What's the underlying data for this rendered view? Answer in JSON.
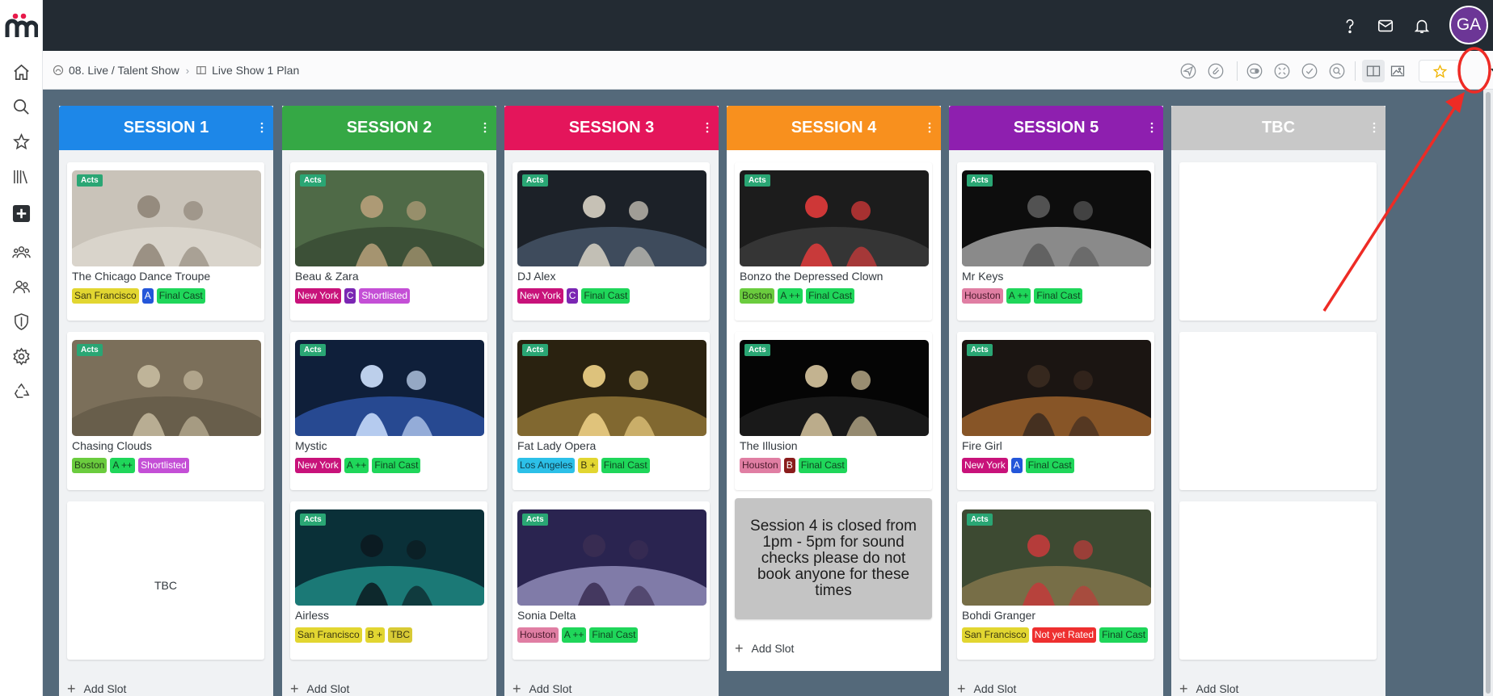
{
  "topbar": {
    "avatar_initials": "GA",
    "icons": [
      "help-icon",
      "mail-icon",
      "bell-icon"
    ]
  },
  "breadcrumb": {
    "workspace": "08. Live / Talent Show",
    "board": "Live Show 1 Plan"
  },
  "colors": {
    "session1": "#1d87e8",
    "session2": "#35a845",
    "session3": "#e4155b",
    "session4": "#f8901e",
    "session5": "#8e1faf",
    "tbc": "#c8c8c8",
    "acts_badge": "#2aa674",
    "annotation": "#ee2b25"
  },
  "columns": [
    {
      "title": "SESSION 1",
      "add_slot": "Add Slot",
      "cards": [
        {
          "badge": "Acts",
          "title": "The Chicago Dance Troupe",
          "tags": [
            {
              "t": "San Francisco",
              "bg": "#e2d631",
              "fg": "#3b3710"
            },
            {
              "t": "A",
              "bg": "#2456d9",
              "fg": "#ffffff"
            },
            {
              "t": "Final Cast",
              "bg": "#1fd65a",
              "fg": "#0f4521"
            }
          ]
        },
        {
          "badge": "Acts",
          "title": "Chasing Clouds",
          "tags": [
            {
              "t": "Boston",
              "bg": "#6bcc3e",
              "fg": "#23401a"
            },
            {
              "t": "A ++",
              "bg": "#1fd65a",
              "fg": "#0f4521"
            },
            {
              "t": "Shortlisted",
              "bg": "#c44fd6",
              "fg": "#ffffff"
            }
          ]
        },
        {
          "empty": "TBC"
        }
      ]
    },
    {
      "title": "SESSION 2",
      "add_slot": "Add Slot",
      "cards": [
        {
          "badge": "Acts",
          "title": "Beau & Zara",
          "tags": [
            {
              "t": "New York",
              "bg": "#c8127a",
              "fg": "#ffffff"
            },
            {
              "t": "C",
              "bg": "#7b26b3",
              "fg": "#ffffff"
            },
            {
              "t": "Shortlisted",
              "bg": "#c44fd6",
              "fg": "#ffffff"
            }
          ]
        },
        {
          "badge": "Acts",
          "title": "Mystic",
          "tags": [
            {
              "t": "New York",
              "bg": "#c8127a",
              "fg": "#ffffff"
            },
            {
              "t": "A ++",
              "bg": "#1fd65a",
              "fg": "#0f4521"
            },
            {
              "t": "Final Cast",
              "bg": "#1fd65a",
              "fg": "#0f4521"
            }
          ]
        },
        {
          "badge": "Acts",
          "title": "Airless",
          "tags": [
            {
              "t": "San Francisco",
              "bg": "#e2d631",
              "fg": "#3b3710"
            },
            {
              "t": "B +",
              "bg": "#e2d631",
              "fg": "#3b3710"
            },
            {
              "t": "TBC",
              "bg": "#d8ca35",
              "fg": "#3b3710"
            }
          ]
        }
      ]
    },
    {
      "title": "SESSION 3",
      "add_slot": "Add Slot",
      "cards": [
        {
          "badge": "Acts",
          "title": "DJ Alex",
          "tags": [
            {
              "t": "New York",
              "bg": "#c8127a",
              "fg": "#ffffff"
            },
            {
              "t": "C",
              "bg": "#7b26b3",
              "fg": "#ffffff"
            },
            {
              "t": "Final Cast",
              "bg": "#1fd65a",
              "fg": "#0f4521"
            }
          ]
        },
        {
          "badge": "Acts",
          "title": "Fat Lady Opera",
          "tags": [
            {
              "t": "Los Angeles",
              "bg": "#2cc0e8",
              "fg": "#0f3d4a"
            },
            {
              "t": "B +",
              "bg": "#e2d631",
              "fg": "#3b3710"
            },
            {
              "t": "Final Cast",
              "bg": "#1fd65a",
              "fg": "#0f4521"
            }
          ]
        },
        {
          "badge": "Acts",
          "title": "Sonia Delta",
          "tags": [
            {
              "t": "Houston",
              "bg": "#e07ea3",
              "fg": "#4a1a2c"
            },
            {
              "t": "A ++",
              "bg": "#1fd65a",
              "fg": "#0f4521"
            },
            {
              "t": "Final Cast",
              "bg": "#1fd65a",
              "fg": "#0f4521"
            }
          ]
        }
      ]
    },
    {
      "title": "SESSION 4",
      "add_slot": "Add Slot",
      "cards": [
        {
          "badge": "Acts",
          "title": "Bonzo the Depressed Clown",
          "tags": [
            {
              "t": "Boston",
              "bg": "#6bcc3e",
              "fg": "#23401a"
            },
            {
              "t": "A ++",
              "bg": "#1fd65a",
              "fg": "#0f4521"
            },
            {
              "t": "Final Cast",
              "bg": "#1fd65a",
              "fg": "#0f4521"
            }
          ]
        },
        {
          "badge": "Acts",
          "title": "The Illusion",
          "tags": [
            {
              "t": "Houston",
              "bg": "#e07ea3",
              "fg": "#4a1a2c"
            },
            {
              "t": "B",
              "bg": "#8a1c1c",
              "fg": "#ffffff"
            },
            {
              "t": "Final Cast",
              "bg": "#1fd65a",
              "fg": "#0f4521"
            }
          ]
        },
        {
          "note": "Session 4 is closed from 1pm - 5pm for sound checks please do not book anyone for these times"
        }
      ]
    },
    {
      "title": "SESSION 5",
      "add_slot": "Add Slot",
      "cards": [
        {
          "badge": "Acts",
          "title": "Mr Keys",
          "tags": [
            {
              "t": "Houston",
              "bg": "#e07ea3",
              "fg": "#4a1a2c"
            },
            {
              "t": "A ++",
              "bg": "#1fd65a",
              "fg": "#0f4521"
            },
            {
              "t": "Final Cast",
              "bg": "#1fd65a",
              "fg": "#0f4521"
            }
          ]
        },
        {
          "badge": "Acts",
          "title": "Fire Girl",
          "tags": [
            {
              "t": "New York",
              "bg": "#c8127a",
              "fg": "#ffffff"
            },
            {
              "t": "A",
              "bg": "#2456d9",
              "fg": "#ffffff"
            },
            {
              "t": "Final Cast",
              "bg": "#1fd65a",
              "fg": "#0f4521"
            }
          ]
        },
        {
          "badge": "Acts",
          "title": "Bohdi Granger",
          "tags": [
            {
              "t": "San Francisco",
              "bg": "#e2d631",
              "fg": "#3b3710"
            },
            {
              "t": "Not yet Rated",
              "bg": "#ee2f2f",
              "fg": "#ffffff"
            },
            {
              "t": "Final Cast",
              "bg": "#1fd65a",
              "fg": "#0f4521"
            }
          ]
        }
      ]
    },
    {
      "title": "TBC",
      "add_slot": "Add Slot",
      "cards": [
        {
          "blank": true
        },
        {
          "blank": true
        },
        {
          "blank": true
        }
      ]
    }
  ]
}
